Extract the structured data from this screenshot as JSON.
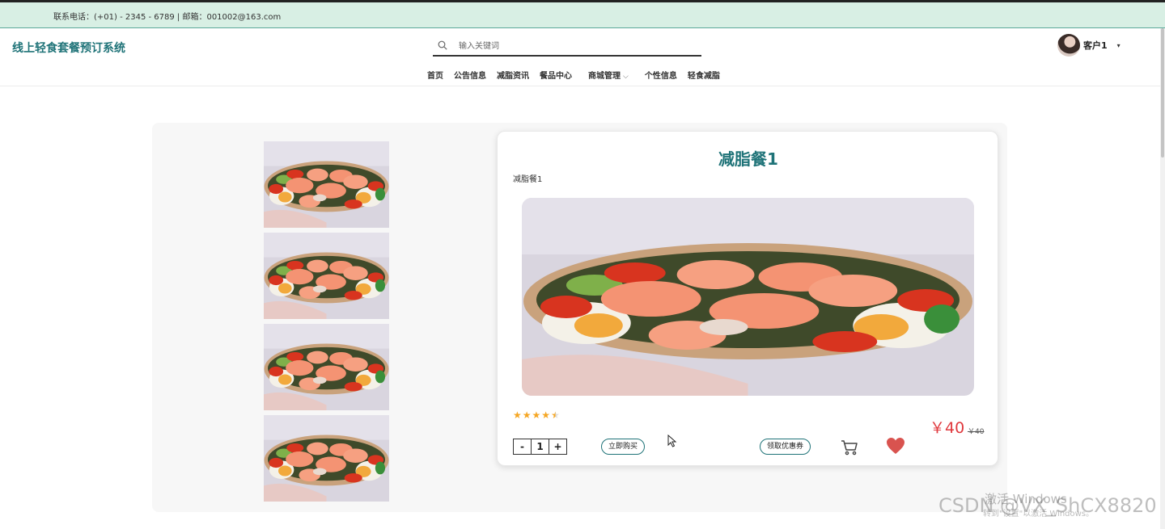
{
  "topbar": {
    "contact": "联系电话：(+01) - 2345 - 6789 | 邮箱：001002@163.com"
  },
  "header": {
    "logo": "线上轻食套餐预订系统",
    "search_placeholder": "输入关键词",
    "user_name": "客户1",
    "user_caret": "▾"
  },
  "nav": [
    {
      "label": "首页"
    },
    {
      "label": "公告信息"
    },
    {
      "label": "减脂资讯"
    },
    {
      "label": "餐品中心"
    },
    {
      "label": "商城管理",
      "chevron": "⌵"
    },
    {
      "label": "个性信息"
    },
    {
      "label": "轻食减脂"
    }
  ],
  "product": {
    "title": "减脂餐1",
    "subtitle": "减脂餐1",
    "rating": 4.5,
    "rating_max": 5,
    "price": "￥40",
    "original_price": "￥40",
    "quantity": "1",
    "qty_minus": "-",
    "qty_plus": "+",
    "buy_label": "立即购买",
    "coupon_label": "领取优惠券",
    "thumbnail_count": 4
  },
  "icons": {
    "search": "search-icon",
    "cart": "cart-icon",
    "favorite": "heart-icon"
  },
  "colors": {
    "brand": "#1f7378",
    "price": "#e0393e",
    "star": "#f5a623",
    "heart": "#d9534f",
    "topbar_bg": "#d8efe4"
  },
  "watermarks": {
    "windows_activate": "激活 Windows",
    "windows_sub": "转到\"设置\"以激活 Windows。",
    "csdn": "CSDN @VX_ShCX8820"
  }
}
